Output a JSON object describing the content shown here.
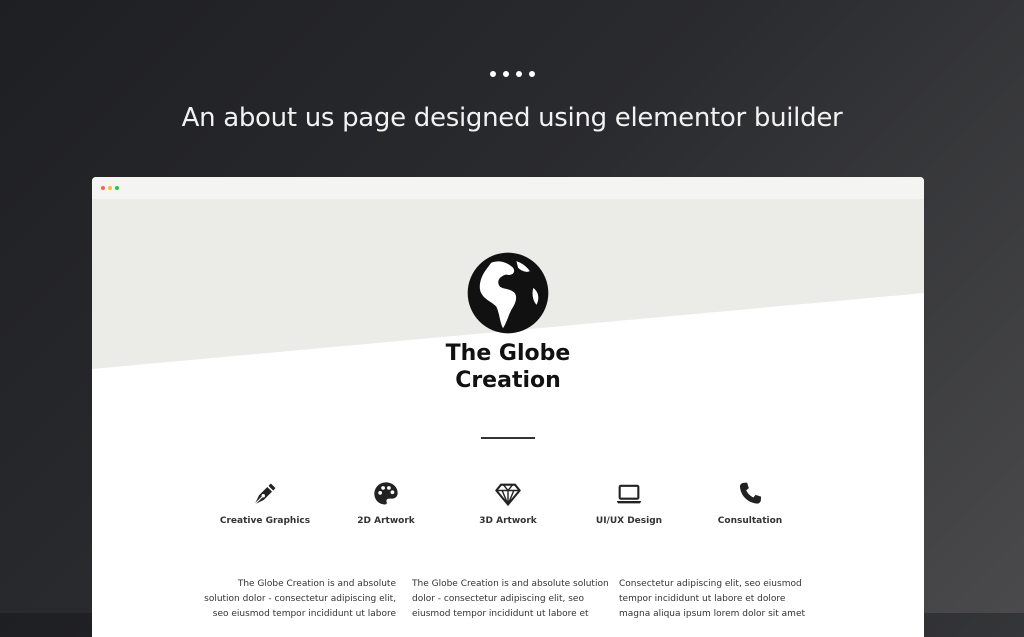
{
  "headline": "An about us page designed using elementor builder",
  "brand": {
    "line1": "The Globe",
    "line2": "Creation"
  },
  "services": [
    {
      "label": "Creative Graphics",
      "icon": "pen-nib-icon"
    },
    {
      "label": "2D Artwork",
      "icon": "palette-icon"
    },
    {
      "label": "3D Artwork",
      "icon": "diamond-icon"
    },
    {
      "label": "UI/UX Design",
      "icon": "laptop-icon"
    },
    {
      "label": "Consultation",
      "icon": "phone-icon"
    }
  ],
  "columns": [
    {
      "line1": "The Globe Creation is and absolute",
      "line2": "solution dolor - consectetur adipiscing elit,",
      "line3": "seo eiusmod tempor incididunt ut labore"
    },
    {
      "line1": "The Globe Creation is and absolute solution",
      "line2": "dolor - consectetur adipiscing elit, seo",
      "line3": "eiusmod tempor incididunt ut labore et"
    },
    {
      "line1": "Consectetur adipiscing elit, seo eiusmod",
      "line2": "tempor incididunt ut labore et dolore",
      "line3": "magna aliqua ipsum lorem dolor sit amet"
    }
  ],
  "colors": {
    "hero_bg": "#ebebe8",
    "text": "#111111",
    "traffic_red": "#ff5f57",
    "traffic_yellow": "#febc2e",
    "traffic_green": "#28c840"
  }
}
